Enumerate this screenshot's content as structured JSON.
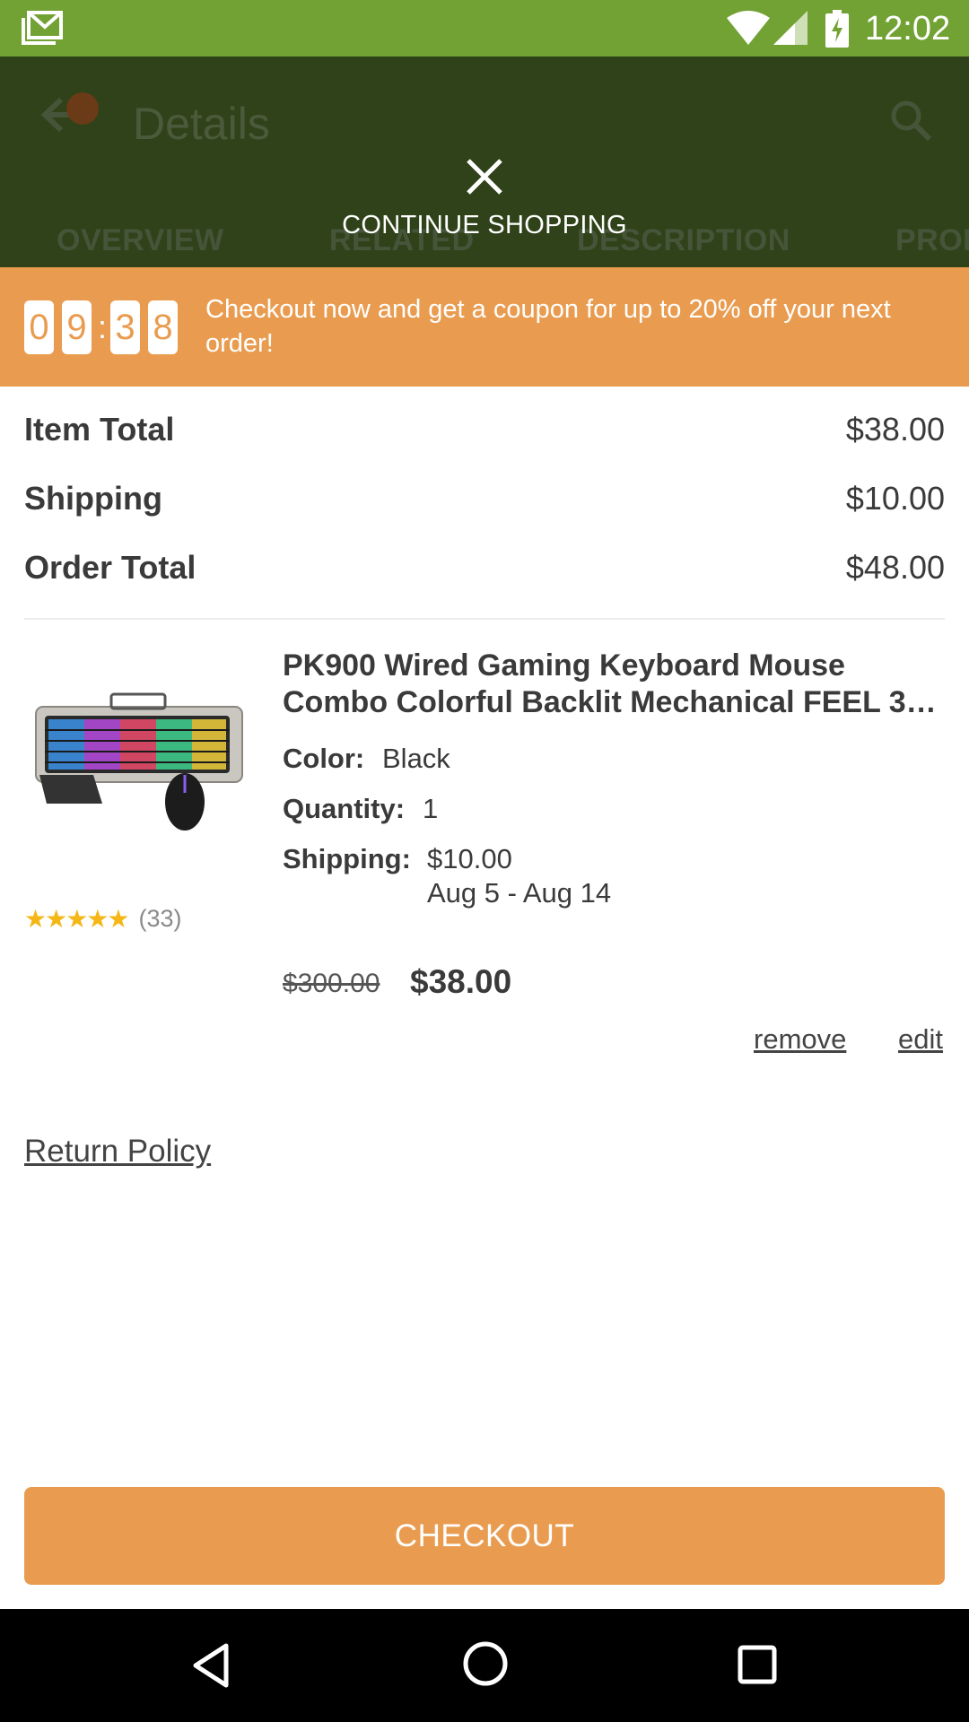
{
  "status_bar": {
    "time": "12:02",
    "icons": [
      "gmail-icon",
      "wifi-icon",
      "signal-icon",
      "battery-charging-icon"
    ]
  },
  "header": {
    "title": "Details",
    "tabs": [
      "OVERVIEW",
      "RELATED",
      "DESCRIPTION",
      "PROD"
    ],
    "continue_shopping": "CONTINUE SHOPPING"
  },
  "promo": {
    "timer": {
      "d1": "0",
      "d2": "9",
      "sep": ":",
      "d3": "3",
      "d4": "8"
    },
    "message": "Checkout now and get a coupon for up to 20% off your next order!"
  },
  "totals": {
    "item_total_label": "Item Total",
    "item_total_value": "$38.00",
    "shipping_label": "Shipping",
    "shipping_value": "$10.00",
    "order_total_label": "Order Total",
    "order_total_value": "$48.00"
  },
  "item": {
    "title_line1": "PK900 Wired Gaming Keyboard Mouse",
    "title_line2": "Combo Colorful Backlit Mechanical FEEL 3…",
    "color_label": "Color:",
    "color_value": "Black",
    "quantity_label": "Quantity:",
    "quantity_value": "1",
    "shipping_label": "Shipping:",
    "shipping_value": "$10.00",
    "shipping_dates": "Aug 5 - Aug 14",
    "rating_stars": "★★★★★",
    "rating": 4.5,
    "rating_count": "(33)",
    "old_price": "$300.00",
    "price": "$38.00",
    "remove_label": "remove",
    "edit_label": "edit"
  },
  "return_policy": "Return Policy",
  "checkout_label": "CHECKOUT",
  "colors": {
    "status_bar": "#71a233",
    "header_dimmed": "#2f4219",
    "accent_orange": "#e99c50",
    "star": "#f5b716"
  }
}
